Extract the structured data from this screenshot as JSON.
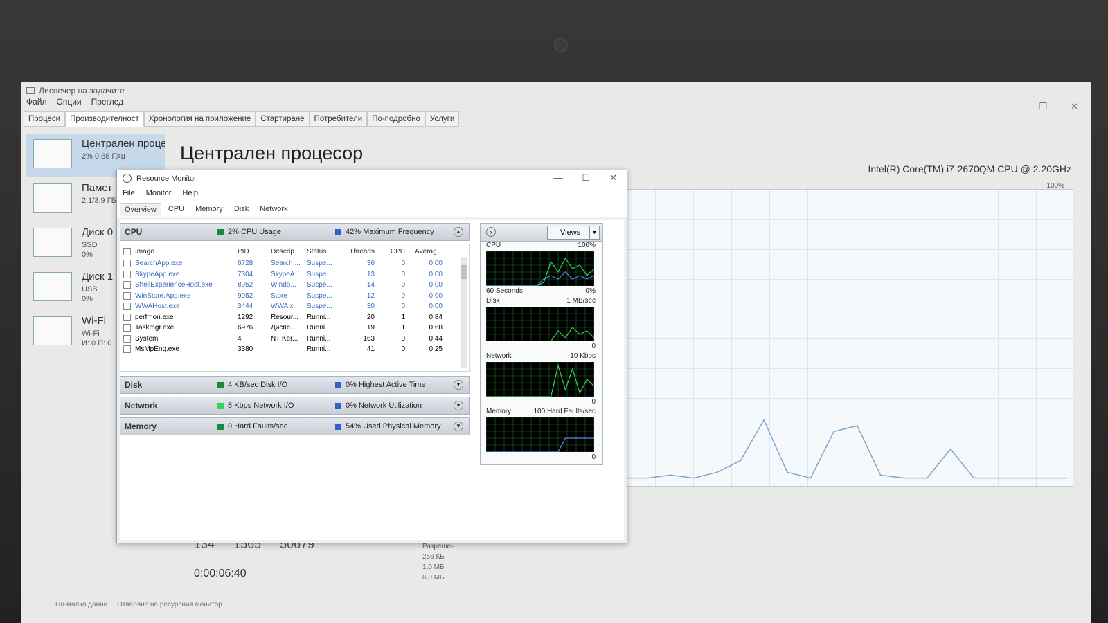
{
  "task_manager": {
    "title": "Диспечер на задачите",
    "menu": [
      "Файл",
      "Опции",
      "Преглед"
    ],
    "tabs": [
      "Процеси",
      "Производителност",
      "Хронология на приложение",
      "Стартиране",
      "Потребители",
      "По-подробно",
      "Услуги"
    ],
    "active_tab": 1,
    "sidebar": [
      {
        "name": "Централен проце",
        "sub1": "2% 0,88 ГХц",
        "sub2": ""
      },
      {
        "name": "Памет",
        "sub1": "2,1/3,9 ГБ",
        "sub2": ""
      },
      {
        "name": "Диск 0",
        "sub1": "SSD",
        "sub2": "0%"
      },
      {
        "name": "Диск 1",
        "sub1": "USB",
        "sub2": "0%"
      },
      {
        "name": "Wi-Fi",
        "sub1": "Wi-Fi",
        "sub2": "И: 0 П: 0"
      }
    ],
    "page_title": "Централен процесор",
    "cpu_model": "Intel(R) Core(TM) i7-2670QM CPU @ 2.20GHz",
    "graph_max": "100%",
    "stats": [
      "134",
      "1565",
      "50679"
    ],
    "uptime": "0:00:06:40",
    "small_stats": [
      "Разрешен",
      "256 КБ",
      "1,0 МБ",
      "6,0 МБ"
    ],
    "bottom_links": [
      "По-малко данни",
      "Отваряне на ресурсния монитор"
    ],
    "big_graph_points": [
      0.02,
      0.02,
      0.03,
      0.02,
      0.04,
      0.08,
      0.22,
      0.04,
      0.02,
      0.18,
      0.2,
      0.03,
      0.02,
      0.02,
      0.12,
      0.02,
      0.02,
      0.02,
      0.02,
      0.02
    ]
  },
  "resource_monitor": {
    "title": "Resource Monitor",
    "menu": [
      "File",
      "Monitor",
      "Help"
    ],
    "tabs": [
      "Overview",
      "CPU",
      "Memory",
      "Disk",
      "Network"
    ],
    "active_tab": 0,
    "cpu_section": {
      "name": "CPU",
      "metric1": "2% CPU Usage",
      "metric2": "42% Maximum Frequency"
    },
    "columns": [
      "Image",
      "PID",
      "Descrip...",
      "Status",
      "Threads",
      "CPU",
      "Averag..."
    ],
    "processes": [
      [
        "SearchApp.exe",
        "6728",
        "Search ...",
        "Suspe...",
        "36",
        "0",
        "0.00"
      ],
      [
        "SkypeApp.exe",
        "7304",
        "SkypeA...",
        "Suspe...",
        "13",
        "0",
        "0.00"
      ],
      [
        "ShellExperienceHost.exe",
        "8952",
        "Windo...",
        "Suspe...",
        "14",
        "0",
        "0.00"
      ],
      [
        "WinStore.App.exe",
        "9052",
        "Store",
        "Suspe...",
        "12",
        "0",
        "0.00"
      ],
      [
        "WWAHost.exe",
        "3444",
        "WWA x...",
        "Suspe...",
        "30",
        "0",
        "0.00"
      ],
      [
        "perfmon.exe",
        "1292",
        "Resour...",
        "Runni...",
        "20",
        "1",
        "0.84"
      ],
      [
        "Taskmgr.exe",
        "6976",
        "Диспе...",
        "Runni...",
        "19",
        "1",
        "0.68"
      ],
      [
        "System",
        "4",
        "NT Ker...",
        "Runni...",
        "163",
        "0",
        "0.44"
      ],
      [
        "MsMpEng.exe",
        "3380",
        "",
        "Runni...",
        "41",
        "0",
        "0.25"
      ]
    ],
    "disk_section": {
      "name": "Disk",
      "metric1": "4 KB/sec Disk I/O",
      "metric2": "0% Highest Active Time"
    },
    "network_section": {
      "name": "Network",
      "metric1": "5 Kbps Network I/O",
      "metric2": "0% Network Utilization"
    },
    "memory_section": {
      "name": "Memory",
      "metric1": "0 Hard Faults/sec",
      "metric2": "54% Used Physical Memory"
    },
    "views_label": "Views",
    "graphs": [
      {
        "label": "CPU",
        "max": "100%",
        "bottom_left": "60 Seconds",
        "bottom_right": "0%"
      },
      {
        "label": "Disk",
        "max": "1 MB/sec",
        "bottom_left": "",
        "bottom_right": "0"
      },
      {
        "label": "Network",
        "max": "10 Kbps",
        "bottom_left": "",
        "bottom_right": "0"
      },
      {
        "label": "Memory",
        "max": "100 Hard Faults/sec",
        "bottom_left": "",
        "bottom_right": "0"
      }
    ],
    "colors": {
      "metric1": "#1c8a3a",
      "metric2": "#2f63c8",
      "graph_green": "#39d353",
      "graph_blue": "#4f8fe6"
    }
  }
}
